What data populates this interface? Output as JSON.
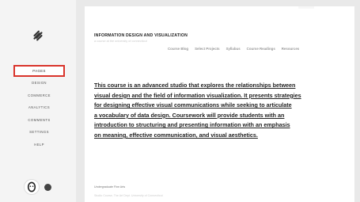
{
  "sidebar": {
    "logo_icon": "squarespace-logo-icon",
    "items": [
      {
        "label": "PAGES",
        "active": true
      },
      {
        "label": "DESIGN",
        "active": false
      },
      {
        "label": "COMMERCE",
        "active": false
      },
      {
        "label": "ANALYTICS",
        "active": false
      },
      {
        "label": "COMMENTS",
        "active": false
      },
      {
        "label": "SETTINGS",
        "active": false
      },
      {
        "label": "HELP",
        "active": false
      }
    ],
    "highlight_color": "#d9342b",
    "bottom": {
      "avatar_icon": "user-avatar-icon",
      "notification_icon": "notification-dot-icon"
    }
  },
  "site": {
    "title": "INFORMATION DESIGN AND VISUALIZATION",
    "subtitle": "a course at the university of connecticut",
    "nav": [
      "Course Blog",
      "Select Projects",
      "Syllabus",
      "Course Readings",
      "Resources"
    ],
    "intro_lines": [
      "This course is an advanced studio that explores the relationships between",
      "visual design and the field of information visualization. It presents strategies",
      "for designing effective visual communications while seeking to articulate",
      "a vocabulary of data design. Coursework will provide students with an",
      "introduction to structuring and presenting information with an emphasis",
      "on meaning, effective communication, and visual aesthetics."
    ],
    "footer_line_1": "Undergraduate Fine Arts",
    "footer_line_2": "Studio Course, The Art Dept. University of Connecticut"
  }
}
